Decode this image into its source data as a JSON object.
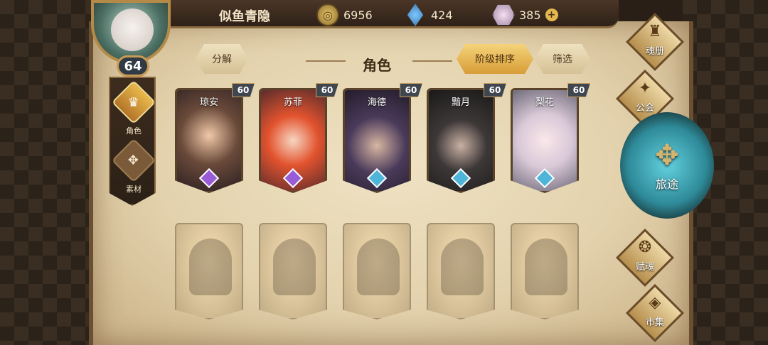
{
  "player": {
    "name": "似鱼青隐",
    "level": "64"
  },
  "currencies": {
    "coin": {
      "value": "6956",
      "icon": "coin-icon"
    },
    "crystal": {
      "value": "424",
      "icon": "blue-crystal-icon"
    },
    "gem": {
      "value": "385",
      "icon": "gem-icon",
      "add": "+"
    }
  },
  "side_tabs": [
    {
      "label": "角色",
      "icon": "character-tab-icon",
      "active": true
    },
    {
      "label": "素材",
      "icon": "material-tab-icon",
      "active": false
    }
  ],
  "header": {
    "decompose": "分解",
    "title": "角色",
    "sort": "阶级排序",
    "filter": "筛选"
  },
  "characters": [
    {
      "name": "琼安",
      "level": "60",
      "rank_color": "#9a5bd6"
    },
    {
      "name": "苏菲",
      "level": "60",
      "rank_color": "#9a5bd6"
    },
    {
      "name": "海德",
      "level": "60",
      "rank_color": "#4fb5d8"
    },
    {
      "name": "黯月",
      "level": "60",
      "rank_color": "#4fb5d8"
    },
    {
      "name": "梨花",
      "level": "60",
      "rank_color": "#4fb5d8"
    }
  ],
  "locked_characters": 5,
  "nav": {
    "soul": "魂册",
    "guild": "公会",
    "journey": "旅途",
    "talent": "赋魂",
    "market": "市集"
  }
}
